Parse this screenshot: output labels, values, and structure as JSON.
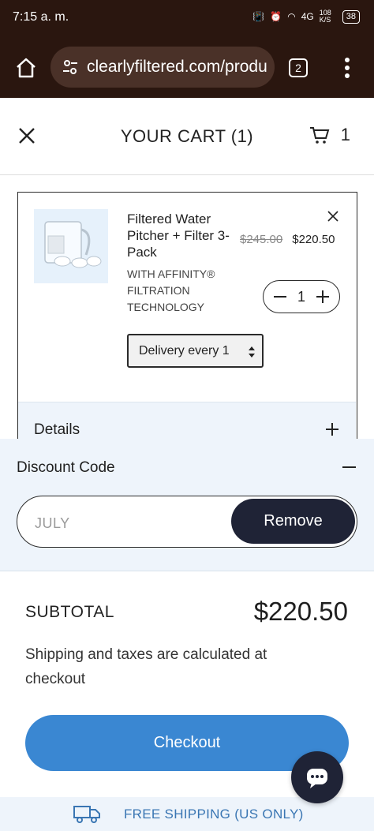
{
  "status_bar": {
    "time": "7:15 a. m.",
    "network": "4G",
    "speed": "108 K/S",
    "battery": "38"
  },
  "browser": {
    "url": "clearlyfiltered.com/produ",
    "tab_count": "2"
  },
  "cart": {
    "title": "YOUR CART (1)",
    "cart_count": "1",
    "item": {
      "name": "Filtered Water Pitcher + Filter 3-Pack",
      "old_price": "$245.00",
      "price": "$220.50",
      "subtitle": "WITH AFFINITY® FILTRATION TECHNOLOGY",
      "quantity": "1",
      "delivery_option": "Delivery every 1",
      "details_label": "Details"
    },
    "discount": {
      "label": "Discount Code",
      "code_value": "JULY",
      "remove_label": "Remove"
    },
    "summary": {
      "subtotal_label": "SUBTOTAL",
      "subtotal_value": "$220.50",
      "shipping_note": "Shipping and taxes are calculated at checkout",
      "checkout_label": "Checkout"
    },
    "shipping_banner": "FREE SHIPPING (US ONLY)"
  },
  "colors": {
    "browser_chrome": "#2a160f",
    "accent": "#3a87d2",
    "dark_button": "#1f2336",
    "light_panel": "#eef4fb"
  },
  "icons": [
    "home-icon",
    "tune-icon",
    "tabs-icon",
    "kebab-menu-icon",
    "close-icon",
    "cart-icon",
    "remove-item-icon",
    "minus-icon",
    "plus-icon",
    "select-arrows-icon",
    "chat-icon",
    "truck-icon"
  ]
}
